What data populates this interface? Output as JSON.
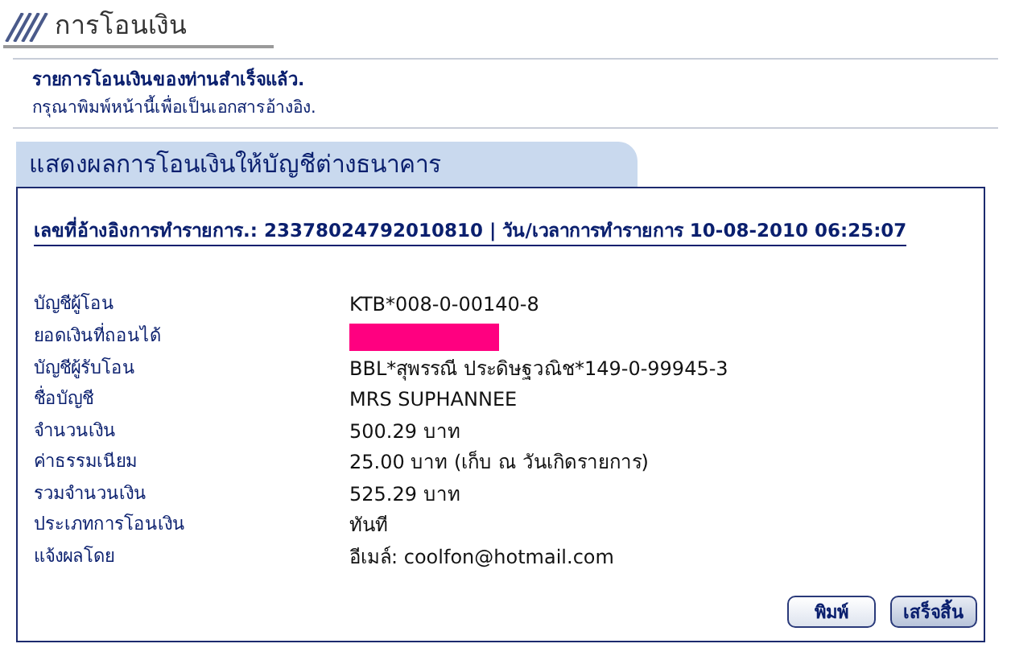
{
  "page_title": "การโอนเงิน",
  "message": {
    "headline": "รายการโอนเงินของท่านสำเร็จแล้ว.",
    "note": "กรุณาพิมพ์หน้านี้เพื่อเป็นเอกสารอ้างอิง."
  },
  "panel": {
    "title": "แสดงผลการโอนเงินให้บัญชีต่างธนาคาร",
    "reference": "เลขที่อ้างอิงการทำรายการ.: 23378024792010810 | วัน/เวลาการทำรายการ 10-08-2010 06:25:07",
    "rows": [
      {
        "kind": "text",
        "label": "บัญชีผู้โอน",
        "value": "KTB*008-0-00140-8"
      },
      {
        "kind": "redacted",
        "label": "ยอดเงินที่ถอนได้"
      },
      {
        "kind": "text",
        "label": "บัญชีผู้รับโอน",
        "value": "BBL*สุพรรณี ประดิษฐวณิช*149-0-99945-3"
      },
      {
        "kind": "text",
        "label": "ชื่อบัญชี",
        "value": "MRS SUPHANNEE"
      },
      {
        "kind": "text",
        "label": "จำนวนเงิน",
        "value": "500.29 บาท"
      },
      {
        "kind": "text",
        "label": "ค่าธรรมเนียม",
        "value": "25.00 บาท  (เก็บ ณ วันเกิดรายการ)"
      },
      {
        "kind": "text",
        "label": "รวมจำนวนเงิน",
        "value": "525.29 บาท"
      },
      {
        "kind": "text",
        "label": "ประเภทการโอนเงิน",
        "value": "ทันที"
      },
      {
        "kind": "text",
        "label": "แจ้งผลโดย",
        "value": "อีเมล์: coolfon@hotmail.com"
      }
    ],
    "buttons": [
      {
        "label": "พิมพ์",
        "selected": false
      },
      {
        "label": "เสร็จสิ้น",
        "selected": true
      }
    ]
  }
}
